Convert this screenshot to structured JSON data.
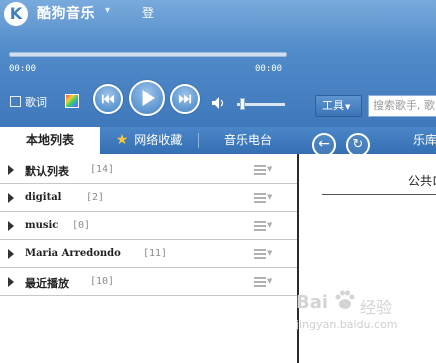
{
  "app": {
    "title": "酷狗音乐",
    "logo_letter": "K",
    "login_text": "登"
  },
  "player": {
    "time_current": "00:00",
    "time_total": "00:00",
    "progress": 0,
    "volume": 0.1,
    "lyric_toggle": {
      "label": "歌词",
      "checked": false
    },
    "icons": [
      "skin-color-icon",
      "prev-track-icon",
      "play-icon",
      "next-track-icon",
      "volume-icon"
    ]
  },
  "toolbar": {
    "tools_label": "工具",
    "search_placeholder": "搜索歌手, 歌"
  },
  "tabs": [
    {
      "label": "本地列表",
      "active": true
    },
    {
      "label": "网络收藏",
      "active": false,
      "icon": "star-icon"
    },
    {
      "label": "音乐电台",
      "active": false
    }
  ],
  "right_nav": {
    "library_label": "乐库",
    "section_title": "公共ロ"
  },
  "playlists": [
    {
      "name": "默认列表",
      "count": "[14]"
    },
    {
      "name": "digital",
      "count": "[2]"
    },
    {
      "name": "music",
      "count": "[0]"
    },
    {
      "name": "Maria Arredondo",
      "count": "[11]"
    },
    {
      "name": "最近播放",
      "count": "[10]"
    }
  ],
  "watermark": {
    "brand": "Bai",
    "brand2": "经验",
    "url": "jingyan.baidu.com"
  },
  "colors": {
    "accent": "#4f89c8",
    "tabbar": "#346fb3",
    "active_tab": "#ffffff",
    "star": "#ffc53a"
  }
}
